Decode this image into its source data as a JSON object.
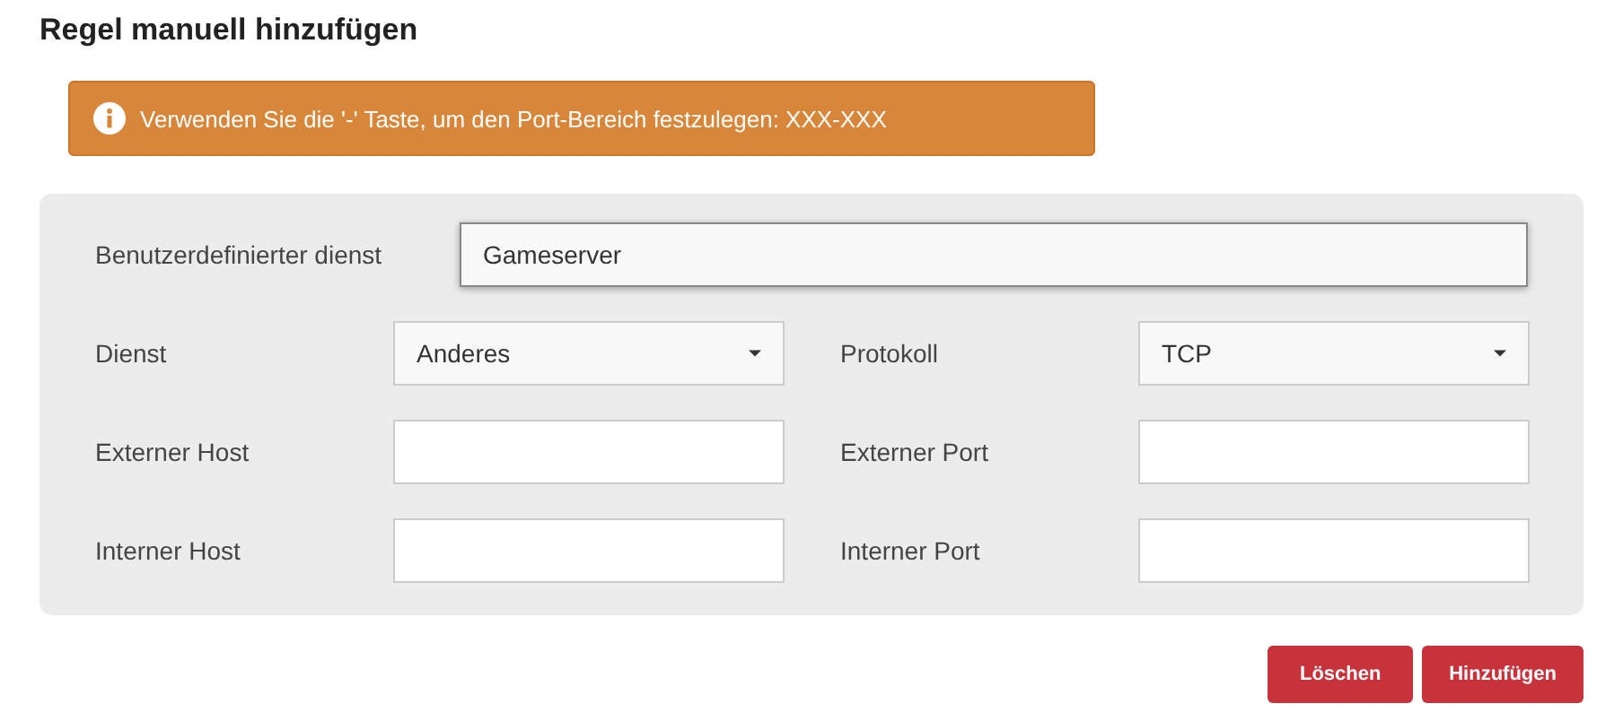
{
  "title": "Regel manuell hinzufügen",
  "alert": {
    "text": "Verwenden Sie die '-' Taste, um den Port-Bereich festzulegen: XXX-XXX"
  },
  "custom_service": {
    "label": "Benutzerdefinierter dienst",
    "value": "Gameserver",
    "focused": true
  },
  "fields": [
    {
      "label": "Dienst",
      "kind": "select",
      "value": "Anderes"
    },
    {
      "label": "Protokoll",
      "kind": "select",
      "value": "TCP"
    },
    {
      "label": "Externer Host",
      "kind": "text"
    },
    {
      "label": "Externer Port",
      "kind": "text"
    },
    {
      "label": "Interner Host",
      "kind": "text"
    },
    {
      "label": "Interner Port",
      "kind": "text"
    }
  ],
  "buttons": [
    "Löschen",
    "Hinzufügen"
  ]
}
